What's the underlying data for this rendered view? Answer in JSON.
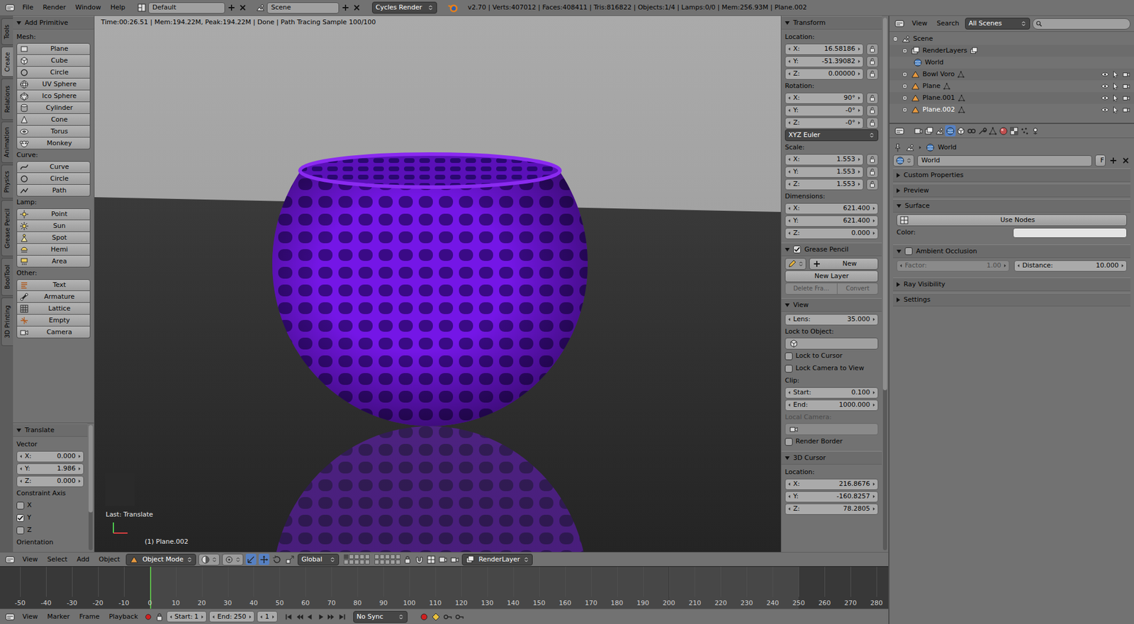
{
  "topbar": {
    "menus": [
      "File",
      "Render",
      "Window",
      "Help"
    ],
    "layout": "Default",
    "scene": "Scene",
    "engine": "Cycles Render",
    "info": "v2.70 | Verts:407012 | Faces:408411 | Tris:816822 | Objects:1/4 | Lamps:0/0 | Mem:256.93M | Plane.002"
  },
  "tool_tabs": [
    {
      "label": "Tools",
      "selected": false
    },
    {
      "label": "Create",
      "selected": true
    },
    {
      "label": "Relations",
      "selected": false
    },
    {
      "label": "Animation",
      "selected": false
    },
    {
      "label": "Physics",
      "selected": false
    },
    {
      "label": "Grease Pencil",
      "selected": false
    },
    {
      "label": "BoolTool",
      "selected": false
    },
    {
      "label": "3D Printing",
      "selected": false
    }
  ],
  "tool_shelf": {
    "panel": {
      "title": "Add Primitive",
      "expanded": true
    },
    "groups": [
      {
        "label": "Mesh:",
        "buttons": [
          "Plane",
          "Cube",
          "Circle",
          "UV Sphere",
          "Ico Sphere",
          "Cylinder",
          "Cone",
          "Torus",
          "Monkey"
        ]
      },
      {
        "label": "Curve:",
        "buttons": [
          "Curve",
          "Circle",
          "Path"
        ]
      },
      {
        "label": "Lamp:",
        "buttons": [
          "Point",
          "Sun",
          "Spot",
          "Hemi",
          "Area"
        ]
      },
      {
        "label": "Other:",
        "buttons": [
          "Text",
          "Armature",
          "Lattice",
          "Empty",
          "Camera"
        ]
      }
    ]
  },
  "operator": {
    "panel": {
      "title": "Translate",
      "expanded": true
    },
    "vector_label": "Vector",
    "vector": [
      {
        "label": "X:",
        "value": "0.000"
      },
      {
        "label": "Y:",
        "value": "1.986"
      },
      {
        "label": "Z:",
        "value": "0.000"
      }
    ],
    "constraint_label": "Constraint Axis",
    "constraints": [
      {
        "label": "X",
        "checked": false
      },
      {
        "label": "Y",
        "checked": true
      },
      {
        "label": "Z",
        "checked": false
      }
    ],
    "orientation_label": "Orientation"
  },
  "viewport": {
    "render_info": "Time:00:26.51 | Mem:194.22M, Peak:194.22M | Done | Path Tracing Sample 100/100",
    "last_operator": "Last: Translate",
    "object_label": "(1) Plane.002"
  },
  "n_panel": {
    "transform": {
      "panel": {
        "title": "Transform",
        "expanded": true
      },
      "location_label": "Location:",
      "location": [
        {
          "label": "X:",
          "value": "16.58186",
          "locked": false
        },
        {
          "label": "Y:",
          "value": "-51.39082",
          "locked": false
        },
        {
          "label": "Z:",
          "value": "0.00000",
          "locked": false
        }
      ],
      "rotation_label": "Rotation:",
      "rotation": [
        {
          "label": "X:",
          "value": "90°",
          "locked": false
        },
        {
          "label": "Y:",
          "value": "-0°",
          "locked": false
        },
        {
          "label": "Z:",
          "value": "-0°",
          "locked": false
        }
      ],
      "rotation_mode": "XYZ Euler",
      "scale_label": "Scale:",
      "scale": [
        {
          "label": "X:",
          "value": "1.553",
          "locked": false
        },
        {
          "label": "Y:",
          "value": "1.553",
          "locked": false
        },
        {
          "label": "Z:",
          "value": "1.553",
          "locked": false
        }
      ],
      "dimensions_label": "Dimensions:",
      "dimensions": [
        {
          "label": "X:",
          "value": "621.400"
        },
        {
          "label": "Y:",
          "value": "621.400"
        },
        {
          "label": "Z:",
          "value": "0.000"
        }
      ]
    },
    "grease_pencil": {
      "panel": {
        "title": "Grease Pencil",
        "expanded": true,
        "checked": true
      },
      "new": "New",
      "new_layer": "New Layer",
      "delete_frame": "Delete Fra...",
      "convert": "Convert",
      "frame_actions_disabled": true
    },
    "view": {
      "panel": {
        "title": "View",
        "expanded": true
      },
      "lens_label": "Lens:",
      "lens": "35.000",
      "lock_object_label": "Lock to Object:",
      "checks": [
        {
          "label": "Lock to Cursor",
          "checked": false
        },
        {
          "label": "Lock Camera to View",
          "checked": false
        }
      ],
      "clip_label": "Clip:",
      "clip": [
        {
          "label": "Start:",
          "value": "0.100"
        },
        {
          "label": "End:",
          "value": "1000.000"
        }
      ],
      "local_camera_label": "Local Camera:",
      "local_camera_disabled": true,
      "render_border": {
        "label": "Render Border",
        "checked": false
      }
    },
    "cursor": {
      "panel": {
        "title": "3D Cursor",
        "expanded": true
      },
      "location_label": "Location:",
      "location": [
        {
          "label": "X:",
          "value": "216.8676"
        },
        {
          "label": "Y:",
          "value": "-160.8257"
        },
        {
          "label": "Z:",
          "value": "78.2805"
        }
      ]
    }
  },
  "view_header": {
    "menus": [
      "View",
      "Select",
      "Add",
      "Object"
    ],
    "mode": "Object Mode",
    "manipulators": [
      {
        "selected": true
      },
      {
        "selected": true
      },
      {
        "selected": false
      },
      {
        "selected": false
      }
    ],
    "orientation": "Global",
    "layers": [
      {
        "selected": true
      },
      {
        "selected": false
      },
      {
        "selected": false
      },
      {
        "selected": false
      },
      {
        "selected": false
      },
      {
        "selected": false
      },
      {
        "selected": false
      },
      {
        "selected": false
      },
      {
        "selected": false
      },
      {
        "selected": false
      },
      {
        "selected": false
      },
      {
        "selected": false
      },
      {
        "selected": false
      },
      {
        "selected": false
      },
      {
        "selected": false
      },
      {
        "selected": false
      },
      {
        "selected": false
      },
      {
        "selected": false
      },
      {
        "selected": false
      },
      {
        "selected": false
      }
    ],
    "render_layer": "RenderLayer"
  },
  "timeline": {
    "ticks": [
      {
        "label": "-50",
        "in_range": false,
        "current": false
      },
      {
        "label": "-40",
        "in_range": false,
        "current": false
      },
      {
        "label": "-30",
        "in_range": false,
        "current": false
      },
      {
        "label": "-20",
        "in_range": false,
        "current": false
      },
      {
        "label": "-10",
        "in_range": false,
        "current": false
      },
      {
        "label": "0",
        "in_range": true,
        "current": true
      },
      {
        "label": "10",
        "in_range": true,
        "current": false
      },
      {
        "label": "20",
        "in_range": true,
        "current": false
      },
      {
        "label": "30",
        "in_range": true,
        "current": false
      },
      {
        "label": "40",
        "in_range": true,
        "current": false
      },
      {
        "label": "50",
        "in_range": true,
        "current": false
      },
      {
        "label": "60",
        "in_range": true,
        "current": false
      },
      {
        "label": "70",
        "in_range": true,
        "current": false
      },
      {
        "label": "80",
        "in_range": true,
        "current": false
      },
      {
        "label": "90",
        "in_range": true,
        "current": false
      },
      {
        "label": "100",
        "in_range": true,
        "current": false
      },
      {
        "label": "110",
        "in_range": true,
        "current": false
      },
      {
        "label": "120",
        "in_range": true,
        "current": false
      },
      {
        "label": "130",
        "in_range": true,
        "current": false
      },
      {
        "label": "140",
        "in_range": true,
        "current": false
      },
      {
        "label": "150",
        "in_range": true,
        "current": false
      },
      {
        "label": "160",
        "in_range": true,
        "current": false
      },
      {
        "label": "170",
        "in_range": true,
        "current": false
      },
      {
        "label": "180",
        "in_range": true,
        "current": false
      },
      {
        "label": "190",
        "in_range": true,
        "current": false
      },
      {
        "label": "200",
        "in_range": true,
        "current": false
      },
      {
        "label": "210",
        "in_range": true,
        "current": false
      },
      {
        "label": "220",
        "in_range": true,
        "current": false
      },
      {
        "label": "230",
        "in_range": true,
        "current": false
      },
      {
        "label": "240",
        "in_range": true,
        "current": false
      },
      {
        "label": "250",
        "in_range": true,
        "current": false
      },
      {
        "label": "260",
        "in_range": false,
        "current": false
      },
      {
        "label": "270",
        "in_range": false,
        "current": false
      },
      {
        "label": "280",
        "in_range": false,
        "current": false
      }
    ],
    "menus": [
      "View",
      "Marker",
      "Frame",
      "Playback"
    ],
    "start_label": "Start:",
    "start": "1",
    "end_label": "End:",
    "end": "250",
    "frame": "1",
    "sync": "No Sync"
  },
  "outliner": {
    "menus": [
      "View",
      "Search"
    ],
    "filter": "All Scenes",
    "items": [
      {
        "label": "Scene",
        "kind": "scene",
        "expanded": true,
        "selected": false
      },
      {
        "label": "RenderLayers",
        "kind": "renderlayers",
        "expanded": false,
        "selected": false
      },
      {
        "label": "World",
        "kind": "world",
        "selected": false
      },
      {
        "label": "Bowl Voro",
        "kind": "object",
        "expanded": false,
        "selected": false
      },
      {
        "label": "Plane",
        "kind": "object",
        "expanded": false,
        "selected": false
      },
      {
        "label": "Plane.001",
        "kind": "object",
        "expanded": false,
        "selected": false
      },
      {
        "label": "Plane.002",
        "kind": "object",
        "expanded": false,
        "selected": true
      }
    ]
  },
  "properties": {
    "tabs": [
      {
        "selected": false
      },
      {
        "selected": false
      },
      {
        "selected": false
      },
      {
        "selected": true
      },
      {
        "selected": false
      },
      {
        "selected": false
      },
      {
        "selected": false
      },
      {
        "selected": false
      },
      {
        "selected": false
      },
      {
        "selected": false
      },
      {
        "selected": false
      },
      {
        "selected": false
      }
    ],
    "breadcrumb": "World",
    "datablock": "World",
    "fake_user": "F",
    "panels": [
      {
        "label": "Custom Properties",
        "kind": "plain",
        "expanded": false
      },
      {
        "label": "Preview",
        "kind": "plain",
        "expanded": false
      },
      {
        "label": "Surface",
        "kind": "surface",
        "expanded": true
      },
      {
        "label": "Ambient Occlusion",
        "kind": "ao",
        "expanded": true,
        "checked": false
      },
      {
        "label": "Ray Visibility",
        "kind": "plain",
        "expanded": false
      },
      {
        "label": "Settings",
        "kind": "plain",
        "expanded": false
      }
    ],
    "surface": {
      "use_nodes": "Use Nodes",
      "color_label": "Color:",
      "color": "#e4e4e4"
    },
    "ao": {
      "factor_label": "Factor:",
      "factor": "1.00",
      "factor_disabled": true,
      "distance_label": "Distance:",
      "distance": "10.000"
    }
  }
}
